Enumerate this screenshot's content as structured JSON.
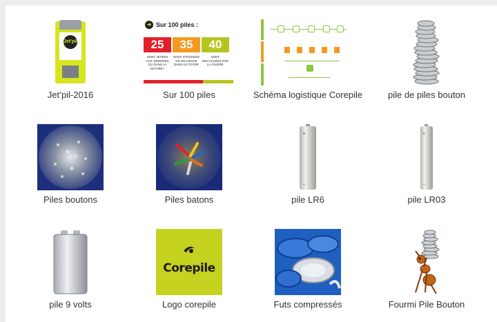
{
  "gallery": {
    "items": [
      {
        "caption": "Jet’pil-2016",
        "kind": "kiosk",
        "badge": "Jet'pil"
      },
      {
        "caption": "Sur 100 piles",
        "kind": "stats",
        "head": "Sur 100 piles :",
        "values": [
          "25",
          "35",
          "40"
        ],
        "labels": [
          "SONT JETÉES AUX ORDURES OU DANS LA NATURE !",
          "SONT STOCKÉES OU EN USAGE DANS LE FOYER",
          "SONT RECYCLÉES PAR LA FILIÈRE"
        ]
      },
      {
        "caption": "Schéma logistique Corepile",
        "kind": "flow"
      },
      {
        "caption": "pile de piles bouton",
        "kind": "stack"
      },
      {
        "caption": "Piles boutons",
        "kind": "texture-buttons"
      },
      {
        "caption": "Piles batons",
        "kind": "texture-sticks"
      },
      {
        "caption": "pile LR6",
        "kind": "battery"
      },
      {
        "caption": "pile LR03",
        "kind": "battery-thin"
      },
      {
        "caption": "pile 9 volts",
        "kind": "ninevolt"
      },
      {
        "caption": "Logo corepile",
        "kind": "logo",
        "logo_text": "Corepile"
      },
      {
        "caption": "Futs compressés",
        "kind": "drums"
      },
      {
        "caption": "Fourmi Pile Bouton",
        "kind": "ant"
      }
    ]
  },
  "colors": {
    "accent_green": "#c5d21f",
    "red": "#e2202a",
    "orange": "#f29a1f",
    "caption_text": "#333333"
  }
}
